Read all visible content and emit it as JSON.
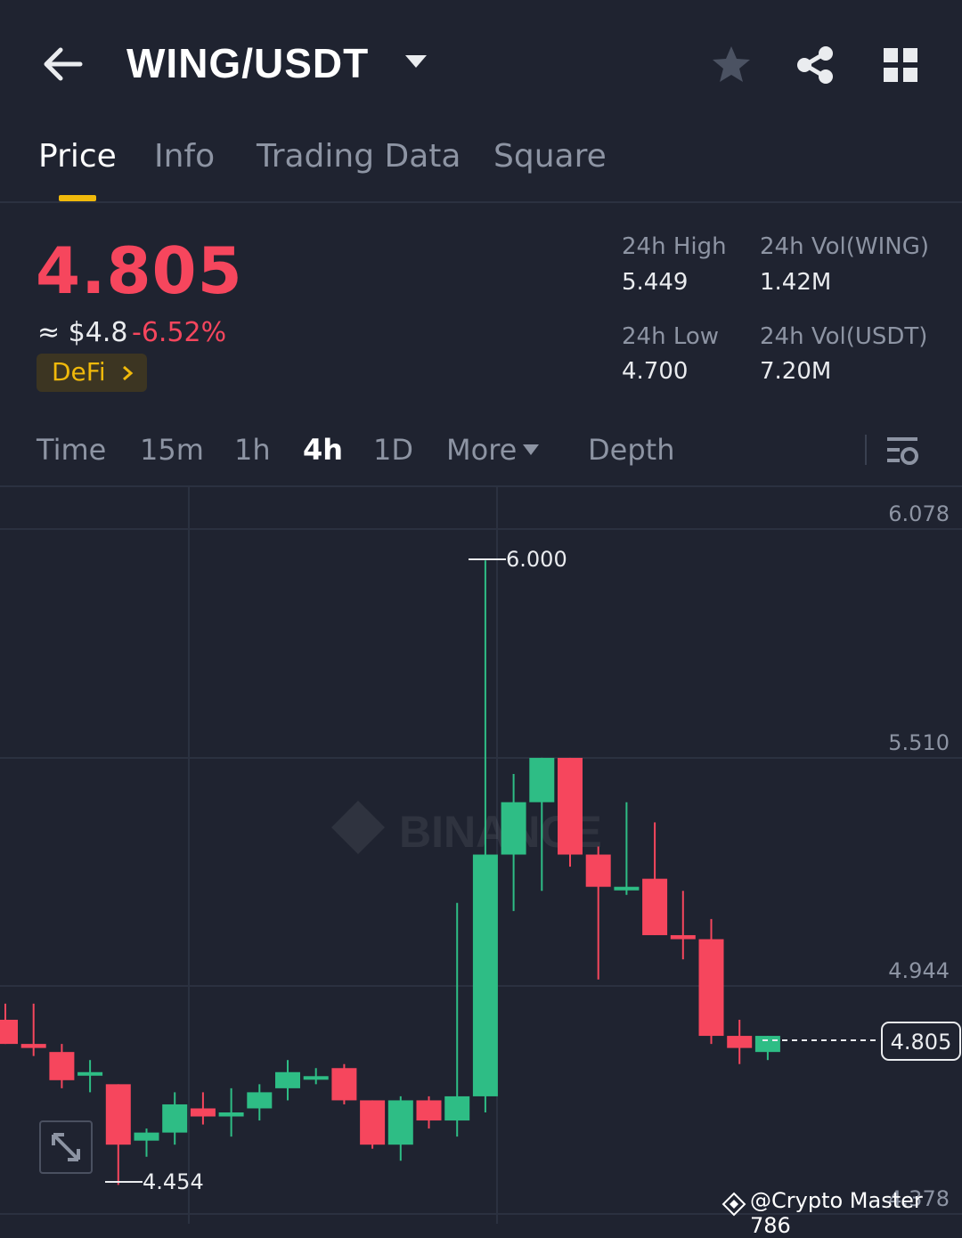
{
  "header": {
    "title": "WING/USDT",
    "icons": [
      "back-arrow-icon",
      "caret-down-icon",
      "star-icon",
      "share-icon",
      "grid-icon"
    ]
  },
  "tabs": [
    {
      "label": "Price",
      "active": true
    },
    {
      "label": "Info",
      "active": false
    },
    {
      "label": "Trading Data",
      "active": false
    },
    {
      "label": "Square",
      "active": false
    }
  ],
  "ticker": {
    "last_price": "4.805",
    "approx_usd": "≈ $4.8",
    "change_pct": "-6.52%",
    "tag": "DeFi",
    "stats": {
      "high_label": "24h High",
      "high_value": "5.449",
      "low_label": "24h Low",
      "low_value": "4.700",
      "vol_base_label": "24h Vol(WING)",
      "vol_base_value": "1.42M",
      "vol_quote_label": "24h Vol(USDT)",
      "vol_quote_value": "7.20M"
    }
  },
  "intervals": [
    {
      "label": "Time",
      "active": false
    },
    {
      "label": "15m",
      "active": false
    },
    {
      "label": "1h",
      "active": false
    },
    {
      "label": "4h",
      "active": true
    },
    {
      "label": "1D",
      "active": false
    },
    {
      "label": "More",
      "active": false
    },
    {
      "label": "Depth",
      "active": false
    }
  ],
  "colors": {
    "up": "#2ebd85",
    "down": "#f6465d",
    "accent": "#f0b90b",
    "background": "#1f2330"
  },
  "chart_data": {
    "type": "candlestick",
    "y_axis_ticks": [
      "6.078",
      "5.510",
      "4.944",
      "4.378"
    ],
    "ylim": [
      4.35,
      6.2
    ],
    "current_price_label": "4.805",
    "high_marker": "6.000",
    "low_marker": "4.454",
    "watermark": "BINANCE",
    "candles": [
      {
        "o": 4.86,
        "h": 4.9,
        "l": 4.8,
        "c": 4.8
      },
      {
        "o": 4.8,
        "h": 4.9,
        "l": 4.77,
        "c": 4.79
      },
      {
        "o": 4.78,
        "h": 4.8,
        "l": 4.69,
        "c": 4.71
      },
      {
        "o": 4.73,
        "h": 4.76,
        "l": 4.68,
        "c": 4.73
      },
      {
        "o": 4.7,
        "h": 4.7,
        "l": 4.45,
        "c": 4.55
      },
      {
        "o": 4.56,
        "h": 4.59,
        "l": 4.52,
        "c": 4.58
      },
      {
        "o": 4.58,
        "h": 4.68,
        "l": 4.55,
        "c": 4.65
      },
      {
        "o": 4.64,
        "h": 4.68,
        "l": 4.6,
        "c": 4.62
      },
      {
        "o": 4.62,
        "h": 4.69,
        "l": 4.57,
        "c": 4.63
      },
      {
        "o": 4.64,
        "h": 4.7,
        "l": 4.61,
        "c": 4.68
      },
      {
        "o": 4.69,
        "h": 4.76,
        "l": 4.66,
        "c": 4.73
      },
      {
        "o": 4.72,
        "h": 4.74,
        "l": 4.7,
        "c": 4.72
      },
      {
        "o": 4.74,
        "h": 4.75,
        "l": 4.65,
        "c": 4.66
      },
      {
        "o": 4.66,
        "h": 4.66,
        "l": 4.54,
        "c": 4.55
      },
      {
        "o": 4.55,
        "h": 4.67,
        "l": 4.51,
        "c": 4.66
      },
      {
        "o": 4.66,
        "h": 4.67,
        "l": 4.59,
        "c": 4.61
      },
      {
        "o": 4.61,
        "h": 5.15,
        "l": 4.57,
        "c": 4.67
      },
      {
        "o": 4.67,
        "h": 6.0,
        "l": 4.63,
        "c": 5.27
      },
      {
        "o": 5.27,
        "h": 5.47,
        "l": 5.13,
        "c": 5.4
      },
      {
        "o": 5.4,
        "h": 5.51,
        "l": 5.18,
        "c": 5.51
      },
      {
        "o": 5.51,
        "h": 5.47,
        "l": 5.24,
        "c": 5.27
      },
      {
        "o": 5.27,
        "h": 5.29,
        "l": 4.96,
        "c": 5.19
      },
      {
        "o": 5.19,
        "h": 5.4,
        "l": 5.17,
        "c": 5.19
      },
      {
        "o": 5.21,
        "h": 5.35,
        "l": 5.11,
        "c": 5.07
      },
      {
        "o": 5.07,
        "h": 5.18,
        "l": 5.01,
        "c": 5.06
      },
      {
        "o": 5.06,
        "h": 5.11,
        "l": 4.8,
        "c": 4.82
      },
      {
        "o": 4.82,
        "h": 4.86,
        "l": 4.75,
        "c": 4.79
      },
      {
        "o": 4.78,
        "h": 4.8,
        "l": 4.76,
        "c": 4.82
      }
    ]
  },
  "credit": "@Crypto Master 786"
}
